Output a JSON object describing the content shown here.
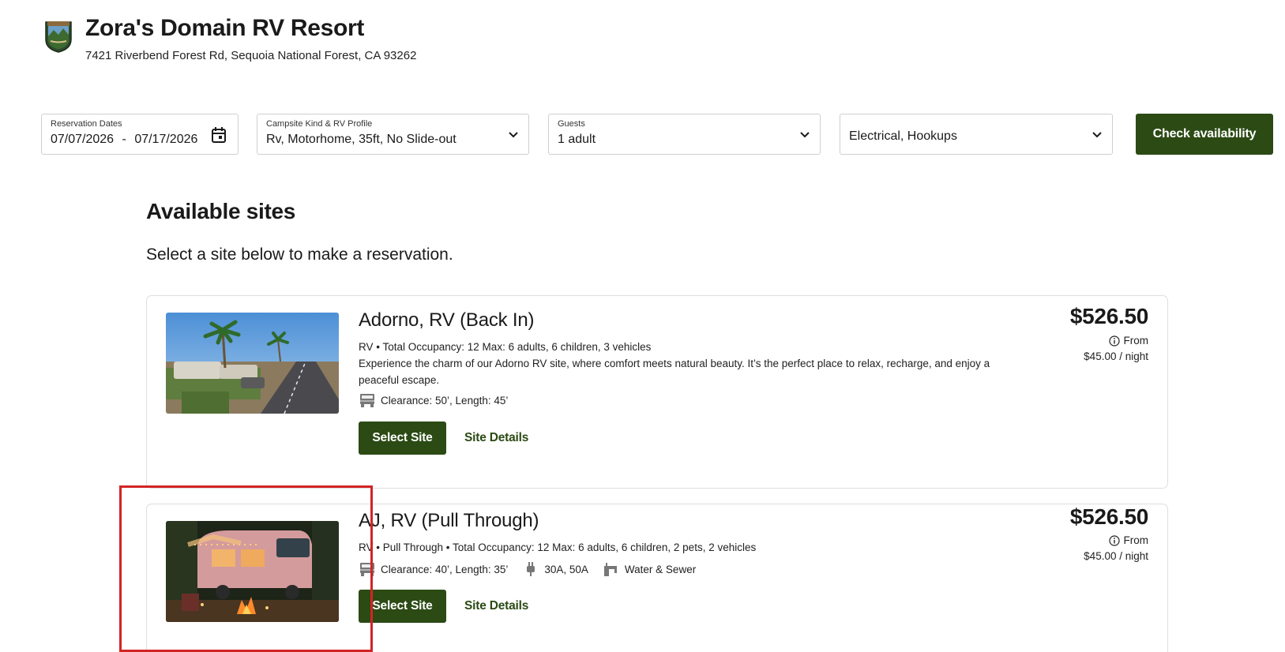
{
  "resort": {
    "name": "Zora's Domain RV Resort",
    "address": "7421 Riverbend Forest Rd, Sequoia National Forest, CA 93262"
  },
  "search": {
    "dates_label": "Reservation Dates",
    "date_start": "07/07/2026",
    "date_sep": "-",
    "date_end": "07/17/2026",
    "campsite_label": "Campsite Kind & RV Profile",
    "campsite_value": "Rv, Motorhome, 35ft, No Slide-out",
    "guests_label": "Guests",
    "guests_value": "1 adult",
    "amenities_value": "Electrical, Hookups",
    "check_button": "Check availability"
  },
  "section": {
    "title": "Available sites",
    "subtitle": "Select a site below to make a reservation."
  },
  "sites": [
    {
      "name": "Adorno, RV (Back In)",
      "meta": "RV • Total Occupancy: 12 Max: 6 adults, 6 children, 3 vehicles",
      "description": "Experience the charm of our Adorno RV site, where comfort meets natural beauty. It’s the perfect place to relax, recharge, and enjoy a peaceful escape.",
      "clearance": "Clearance: 50’, Length: 45’",
      "price": "$526.50",
      "from_label": "From",
      "per_night": "$45.00 / night",
      "select_label": "Select Site",
      "details_label": "Site Details"
    },
    {
      "name": "AJ, RV (Pull Through)",
      "meta": "RV • Pull Through • Total Occupancy: 12 Max: 6 adults, 6 children, 2 pets, 2 vehicles",
      "clearance": "Clearance: 40’, Length: 35’",
      "electric": "30A, 50A",
      "water": "Water & Sewer",
      "price": "$526.50",
      "from_label": "From",
      "per_night": "$45.00 / night",
      "select_label": "Select Site",
      "details_label": "Site Details"
    }
  ],
  "colors": {
    "brand_green": "#2b4a14",
    "highlight_red": "#d32424"
  },
  "icons": [
    "resort-logo",
    "calendar-icon",
    "chevron-down-icon",
    "rv-icon",
    "plug-icon",
    "water-sewer-icon",
    "info-icon"
  ]
}
